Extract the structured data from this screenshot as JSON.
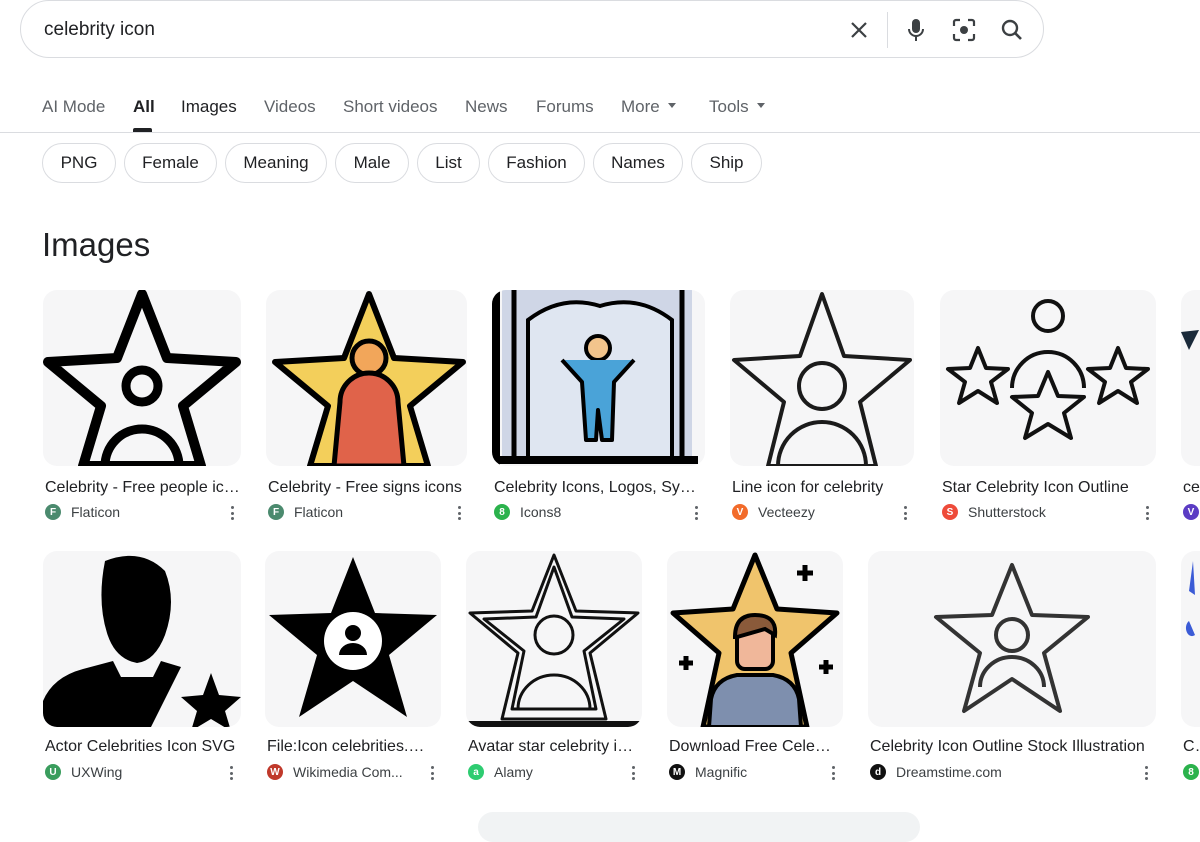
{
  "search": {
    "query": "celebrity icon"
  },
  "tabs": [
    {
      "label": "AI Mode"
    },
    {
      "label": "All"
    },
    {
      "label": "Images"
    },
    {
      "label": "Videos"
    },
    {
      "label": "Short videos"
    },
    {
      "label": "News"
    },
    {
      "label": "Forums"
    },
    {
      "label": "More"
    },
    {
      "label": "Tools"
    }
  ],
  "chips": [
    "PNG",
    "Female",
    "Meaning",
    "Male",
    "List",
    "Fashion",
    "Names",
    "Ship"
  ],
  "section_title": "Images",
  "row1": [
    {
      "title": "Celebrity - Free people icons",
      "source": "Flaticon",
      "fav_color": "#4b8a6e"
    },
    {
      "title": "Celebrity - Free signs icons",
      "source": "Flaticon",
      "fav_color": "#4b8a6e"
    },
    {
      "title": "Celebrity Icons, Logos, Symbols",
      "source": "Icons8",
      "fav_color": "#2bb24c"
    },
    {
      "title": "Line icon for celebrity",
      "source": "Vecteezy",
      "fav_color": "#f26b2a"
    },
    {
      "title": "Star Celebrity Icon Outline",
      "source": "Shutterstock",
      "fav_color": "#ee4b3a"
    },
    {
      "title": "ce",
      "source": "",
      "fav_color": "#5b3cc4"
    }
  ],
  "row2": [
    {
      "title": "Actor Celebrities Icon SVG",
      "source": "UXWing",
      "fav_color": "#3a9d5d"
    },
    {
      "title": "File:Icon celebrities.svg",
      "source": "Wikimedia Com...",
      "fav_color": "#c0392b"
    },
    {
      "title": "Avatar star celebrity icon",
      "source": "Alamy",
      "fav_color": "#2ecc71"
    },
    {
      "title": "Download Free Celebrity",
      "source": "Magnific",
      "fav_color": "#111111"
    },
    {
      "title": "Celebrity Icon Outline Stock Illustration",
      "source": "Dreamstime.com",
      "fav_color": "#111111"
    },
    {
      "title": "Ce",
      "source": "",
      "fav_color": "#2bb24c"
    }
  ]
}
